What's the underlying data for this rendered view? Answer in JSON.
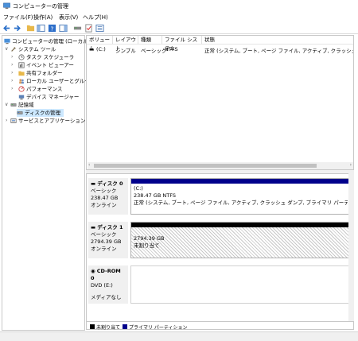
{
  "window": {
    "title": "コンピューターの管理"
  },
  "menu": {
    "items": [
      "ファイル(F)",
      "操作(A)",
      "表示(V)",
      "ヘルプ(H)"
    ]
  },
  "tree": {
    "root": "コンピューターの管理 (ローカル)",
    "system_tools": "システム ツール",
    "task_scheduler": "タスク スケジューラ",
    "event_viewer": "イベント ビューアー",
    "shared_folders": "共有フォルダー",
    "local_users": "ローカル ユーザーとグループ",
    "performance": "パフォーマンス",
    "device_manager": "デバイス マネージャー",
    "storage": "記憶域",
    "disk_management": "ディスクの管理",
    "services_apps": "サービスとアプリケーション"
  },
  "volume_table": {
    "columns": [
      "ボリューム",
      "レイアウト",
      "種類",
      "ファイル システム",
      "状態"
    ],
    "rows": [
      [
        "(C:)",
        "シンプル",
        "ベーシック",
        "NTFS",
        "正常 (システム, ブート, ページ ファイル, アクティブ, クラッシュ ダンプ, プライマリ パ"
      ]
    ]
  },
  "disks": [
    {
      "name": "ディスク 0",
      "type": "ベーシック",
      "size": "238.47 GB",
      "status": "オンライン",
      "part_title": "(C:)",
      "part_size": "238.47 GB NTFS",
      "part_status": "正常 (システム, ブート, ページ ファイル, アクティブ, クラッシュ ダンプ, プライマリ パーティション"
    },
    {
      "name": "ディスク 1",
      "type": "ベーシック",
      "size": "2794.39 GB",
      "status": "オンライン",
      "part_size": "2794.39 GB",
      "part_status": "未割り当て"
    },
    {
      "name": "CD-ROM 0",
      "type": "DVD (E:)",
      "status": "メディアなし"
    }
  ],
  "legend": {
    "unallocated": "未割り当て",
    "primary": "プライマリ パーティション"
  },
  "colors": {
    "primary": "#00008b",
    "unallocated": "#000000",
    "selection": "#cce8ff"
  }
}
